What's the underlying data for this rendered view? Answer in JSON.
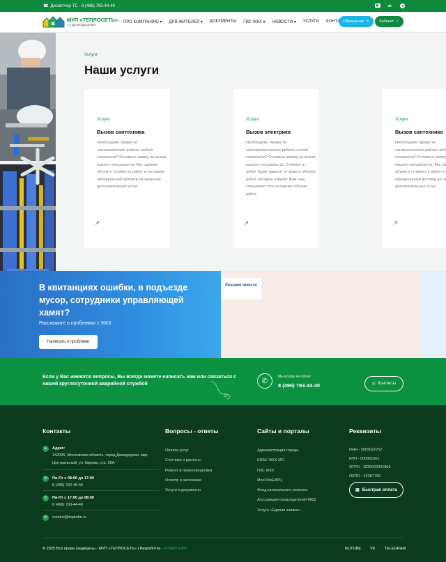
{
  "topbar": {
    "phone": "Диспетчер ТС - 8 (496) 793-44-40",
    "socials": [
      "youtube-icon",
      "vk-icon",
      "telegram-icon"
    ]
  },
  "header": {
    "logo_title": "МУП «ТЕПЛОСЕТЬ»",
    "logo_sub": "г.о.ДОМОДЕДОВО",
    "nav": [
      "ПРО КОМПАНИЮ",
      "ДЛЯ ЖИТЕЛЕЙ",
      "ДОКУМЕНТЫ",
      "ГИС ЖКХ",
      "НОВОСТИ",
      "УСЛУГИ",
      "КОНТАКТЫ"
    ],
    "nav_dropdown": [
      true,
      true,
      false,
      true,
      true,
      false,
      false
    ],
    "appeal_button": "Обращения",
    "cabinet_button": "Кабинет"
  },
  "services": {
    "label": "Услуги",
    "title": "Наши услуги",
    "cards": [
      {
        "tag": "Услуги",
        "title": "Вызов сантехника",
        "description": "Необходимо провести сантехнические работы любой сложности? Оставьте заявку на вызов нашего специалиста. Мы оценим объем и стоимость работ и составим официальный договор на оказание дополнительных услуг.",
        "arrow": "↗"
      },
      {
        "tag": "Услуги",
        "title": "Вызов электрика",
        "description": "Необходимо провести электромонтажные работы любой сложности? Оставьте заявку на вызов нашего специалиста. Стоимость работ будет зависит от вида и объема работ, которую озвучит Вам наш специалист после оценки объема работ.",
        "arrow": "↗"
      },
      {
        "tag": "Услуги",
        "title": "Вызов сантехника",
        "description": "Необходимо провести сантехнические работы любой сложности? Оставьте заявку на вызов нашего специалиста. Мы оценим объем и стоимость работ и составим официальный договор на оказание дополнительных услуг.",
        "arrow": "↗"
      }
    ]
  },
  "banner": {
    "heading": "В квитанциях ошибки, в подъезде мусор, сотрудники управляющей хамят?",
    "subheading": "Расскажите о проблемах с ЖКХ",
    "button": "Написать о проблеме",
    "tab": "Решаем вместе"
  },
  "contact_strip": {
    "text": "Если у Вас имеются вопросы, Вы всегда можете написать нам или связаться с нашей круглосуточной аварийной службой",
    "always": "Мы всегда на связи!",
    "phone": "8 (496) 793-44-40",
    "button": "Контакты"
  },
  "footer": {
    "contacts_title": "Контакты",
    "address_label": "Адрес:",
    "address": "142005, Московская область, город Домодедово, мкр. Центральный, ул. Кирова, стр. 26А",
    "hours1": "Пн-Пт с 08:00 до 17:00",
    "phone1": "8 (496) 792-49-46",
    "hours2": "Пн-Пт с 17:00 до 08:00",
    "phone2": "8 (496) 793-44-40",
    "email": "contact@teplodm.ru",
    "qa_title": "Вопросы - ответы",
    "qa_items": [
      "Оплата услуг",
      "Счетчики и расчеты",
      "Ремонт и перепланировка",
      "Осмотр и заселение",
      "Услуги и документы"
    ],
    "sites_title": "Сайты и порталы",
    "sites_items": [
      "Администрация города",
      "ЕИАС ЖКХ МО",
      "ГИС ЖКХ",
      "МосОблЕИРЦ",
      "Фонд капитального ремонта",
      "Ассоциация председателей МКД",
      "Услуга «Единая заявка»"
    ],
    "req_title": "Реквизиты",
    "req_items": [
      "ИНН - 5009022752",
      "КПП - 500901001",
      "ОГРН - 1035002001869",
      "ОКПО - 42287790"
    ],
    "pay_button": "Быстрая оплата",
    "copyright": "© 2025 Все права защищены - МУП «ТЕПЛОСЕТЬ» | Разработка - ",
    "developer": "VITARTS.RU",
    "links": [
      "RUTUBE",
      "VK",
      "TELEGRAM"
    ]
  },
  "colors": {
    "brand_green": "#0d8a3c",
    "accent_blue": "#1bb6e6",
    "footer_bg": "#0b3a1e"
  }
}
